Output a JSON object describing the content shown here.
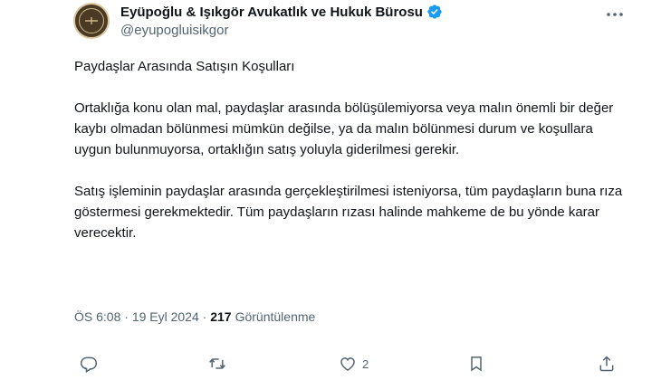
{
  "author": {
    "display_name": "Eyüpoğlu & Işıkgör Avukatlık ve Hukuk Bürosu",
    "handle": "@eyupogluisikgor",
    "verified": true,
    "verified_color": "#1d9bf0"
  },
  "tweet": {
    "paragraphs": [
      "Paydaşlar Arasında Satışın Koşulları",
      "Ortaklığa konu olan mal, paydaşlar arasında bölüşülemiyorsa veya malın önemli bir değer kaybı olmadan bölünmesi mümkün değilse, ya da malın bölünmesi durum ve koşullara uygun bulunmuyorsa, ortaklığın satış yoluyla giderilmesi gerekir.",
      "Satış işleminin paydaşlar arasında gerçekleştirilmesi isteniyorsa, tüm paydaşların buna rıza göstermesi gerekmektedir. Tüm paydaşların rızası halinde mahkeme de bu yönde karar verecektir."
    ]
  },
  "meta": {
    "time": "ÖS 6:08",
    "separator": " · ",
    "date": "19 Eyl 2024",
    "views_count": "217",
    "views_label": "Görüntülenme"
  },
  "actions": {
    "reply": {
      "icon": "reply-icon",
      "count": ""
    },
    "retweet": {
      "icon": "retweet-icon",
      "count": ""
    },
    "like": {
      "icon": "heart-icon",
      "count": "2"
    },
    "bookmark": {
      "icon": "bookmark-icon",
      "count": ""
    },
    "share": {
      "icon": "share-icon",
      "count": ""
    }
  },
  "colors": {
    "text": "#0f1419",
    "secondary": "#536471",
    "accent": "#1d9bf0"
  }
}
